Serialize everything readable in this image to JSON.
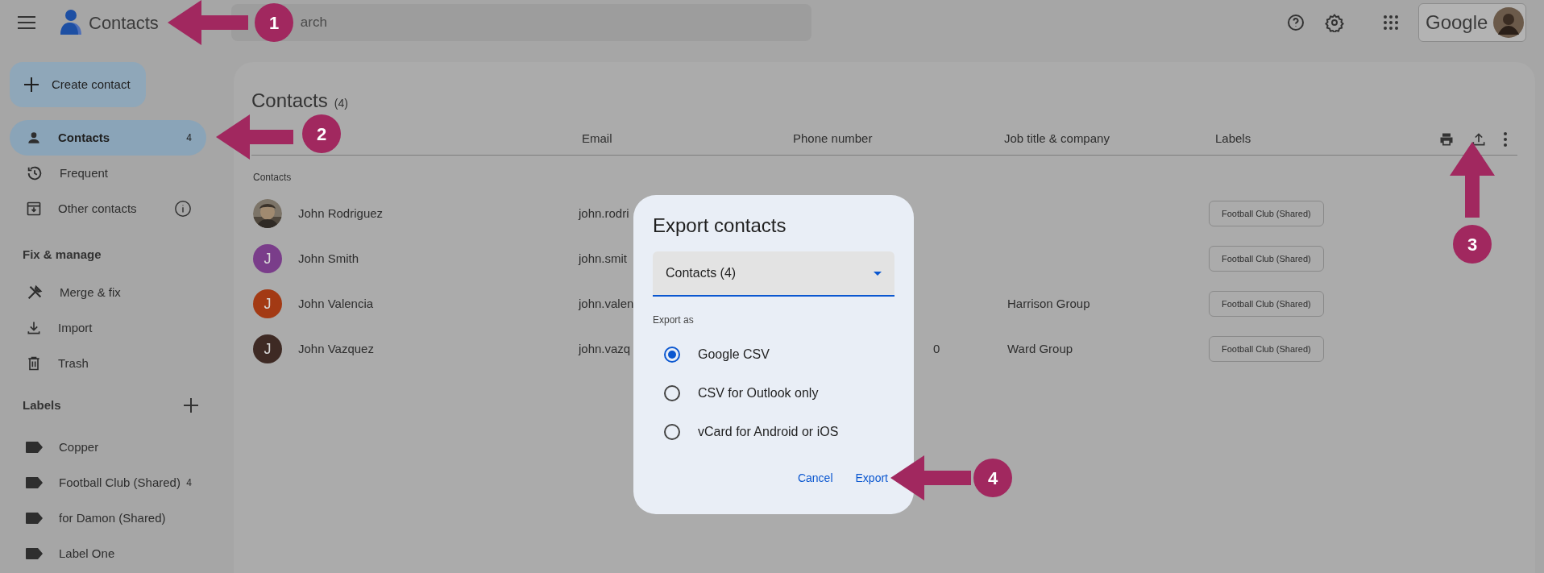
{
  "app_bar": {
    "title": "Contacts",
    "search": {
      "placeholder": "arch"
    },
    "account": {
      "brand": "Google"
    }
  },
  "sidebar": {
    "create_button": "Create contact",
    "nav": [
      {
        "label": "Contacts",
        "count": "4",
        "selected": true
      },
      {
        "label": "Frequent",
        "selected": false
      },
      {
        "label": "Other contacts",
        "info": true,
        "selected": false
      }
    ],
    "fix_heading": "Fix & manage",
    "fix_items": [
      {
        "label": "Merge & fix"
      },
      {
        "label": "Import"
      },
      {
        "label": "Trash"
      }
    ],
    "labels_heading": "Labels",
    "labels": [
      {
        "label": "Copper"
      },
      {
        "label": "Football Club (Shared)",
        "count": "4"
      },
      {
        "label": "for Damon (Shared)"
      },
      {
        "label": "Label One"
      }
    ]
  },
  "main": {
    "title": "Contacts",
    "count": "(4)",
    "columns": [
      "Email",
      "Phone number",
      "Job title & company",
      "Labels"
    ],
    "section": "Contacts",
    "rows": [
      {
        "name": "John Rodriguez",
        "email": "john.rodri",
        "label": "Football Club (Shared)"
      },
      {
        "avatar": {
          "kind": "letter",
          "letter": "J",
          "color": "#7a3d8a"
        },
        "name": "John Smith",
        "email": "john.smit",
        "label": "Football Club (Shared)"
      },
      {
        "avatar": {
          "kind": "letter",
          "letter": "J",
          "color": "#a33a14"
        },
        "name": "John Valencia",
        "email": "john.valen",
        "job": "Harrison Group",
        "label": "Football Club (Shared)"
      },
      {
        "avatar": {
          "kind": "letter",
          "letter": "J",
          "color": "#3e2a24"
        },
        "name": "John Vazquez",
        "email": "john.vazq",
        "phone": "0",
        "job": "Ward Group",
        "label": "Football Club (Shared)"
      }
    ]
  },
  "dialog": {
    "title": "Export contacts",
    "dropdown": {
      "value": "Contacts (4)"
    },
    "export_as": "Export as",
    "options": [
      {
        "label": "Google CSV",
        "selected": true
      },
      {
        "label": "CSV for Outlook only",
        "selected": false
      },
      {
        "label": "vCard for Android or iOS",
        "selected": false
      }
    ],
    "buttons": [
      "Cancel",
      "Export"
    ]
  },
  "annotations": [
    {
      "number": "1"
    },
    {
      "number": "2"
    },
    {
      "number": "3"
    },
    {
      "number": "4"
    }
  ]
}
